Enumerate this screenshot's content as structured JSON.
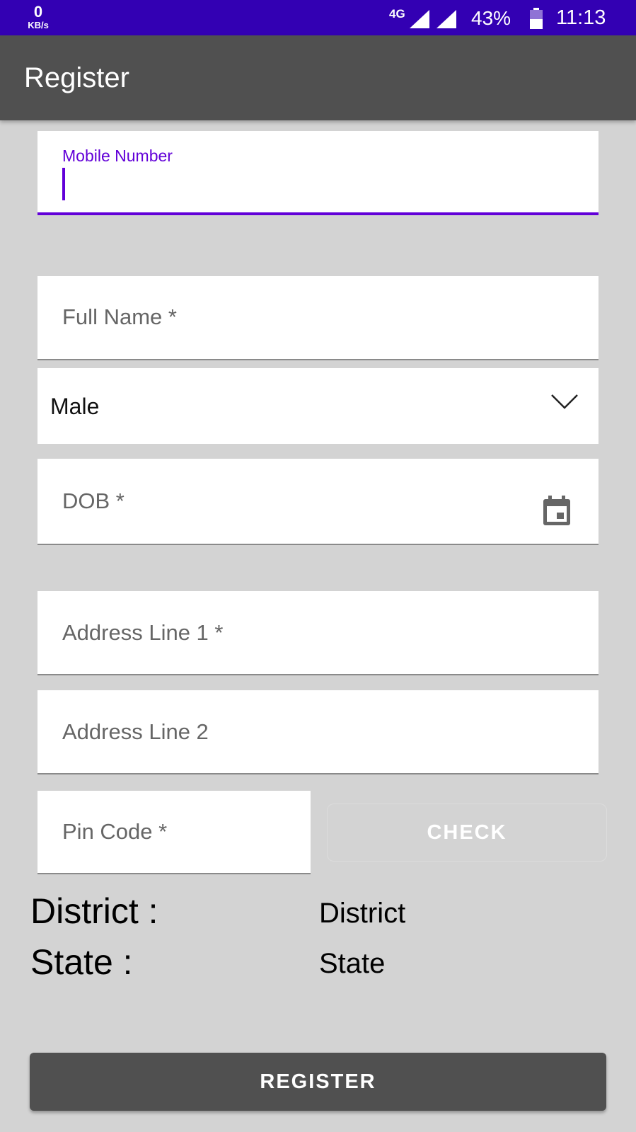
{
  "status_bar": {
    "net_speed_value": "0",
    "net_speed_unit": "KB/s",
    "network_type": "4G",
    "battery_percent": "43%",
    "time": "11:13",
    "background_color": "#3300b3"
  },
  "app_bar": {
    "title": "Register",
    "background_color": "#505050"
  },
  "form": {
    "mobile": {
      "label": "Mobile Number",
      "value": ""
    },
    "full_name": {
      "placeholder": "Full Name *",
      "value": ""
    },
    "gender": {
      "selected": "Male",
      "icon": "chevron-down-icon"
    },
    "dob": {
      "placeholder": "DOB *",
      "icon": "calendar-icon"
    },
    "address1": {
      "placeholder": "Address Line 1 *"
    },
    "address2": {
      "placeholder": "Address Line 2"
    },
    "pin_code": {
      "placeholder": "Pin Code *"
    },
    "check_button": "CHECK"
  },
  "location": {
    "district_label": "District :",
    "district_value": "District",
    "state_label": "State :",
    "state_value": "State"
  },
  "register_button": "REGISTER",
  "colors": {
    "accent": "#6200d8",
    "page_background": "#d3d3d3"
  }
}
